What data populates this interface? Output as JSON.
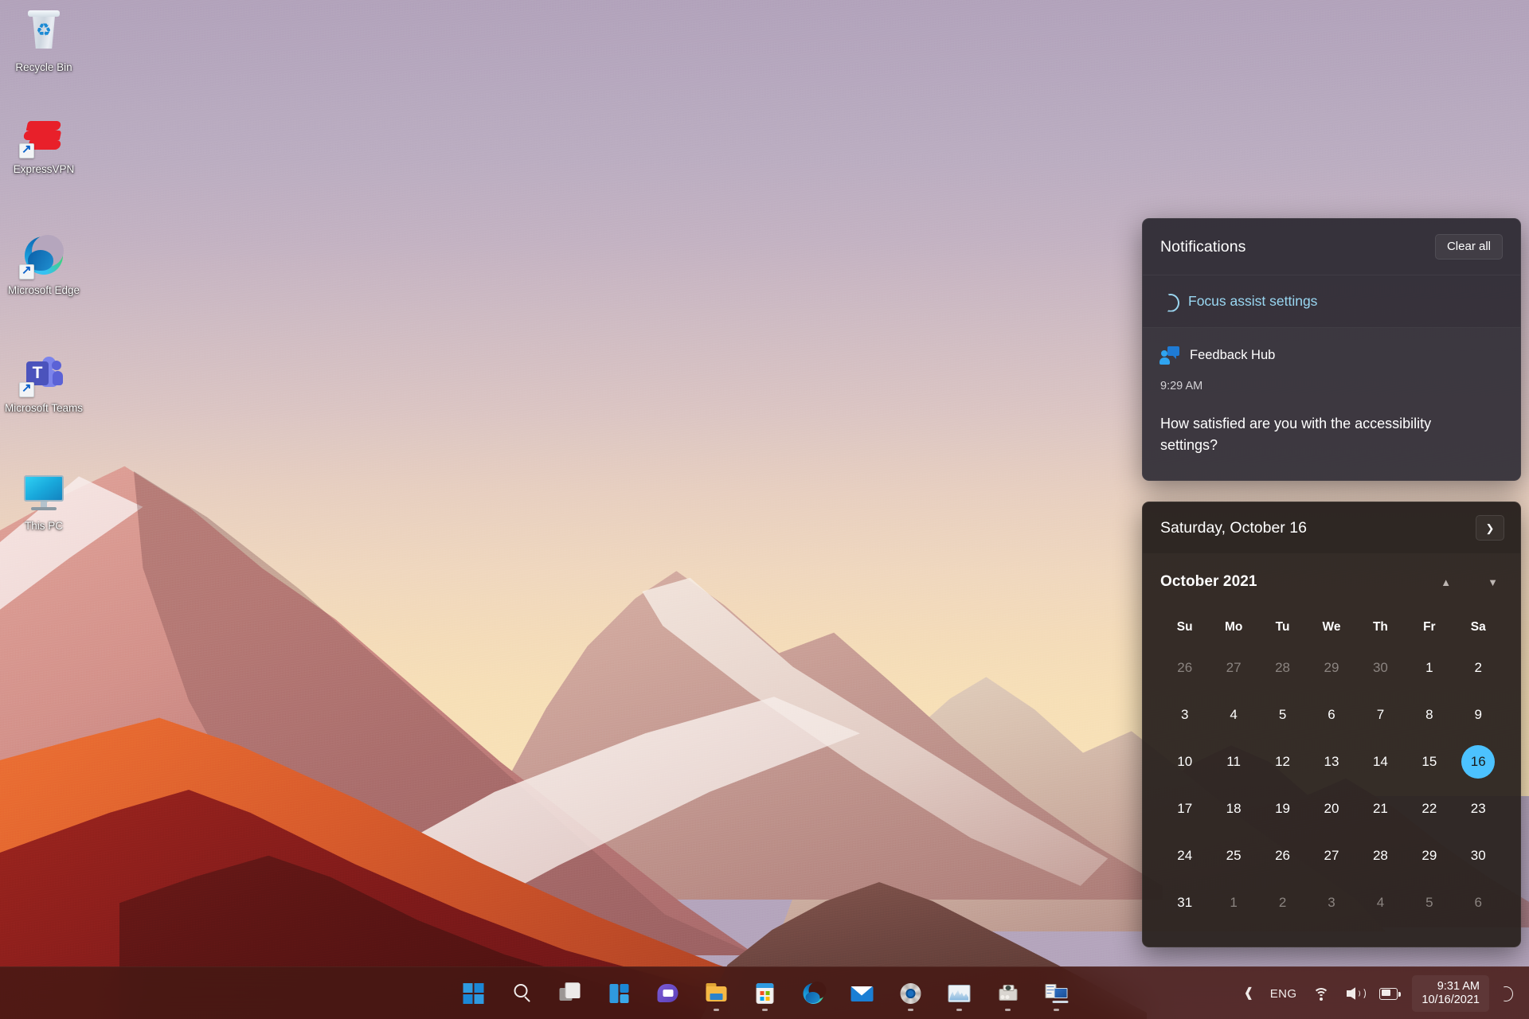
{
  "desktop": {
    "icons": [
      {
        "label": "Recycle Bin",
        "icon": "recycle-bin-icon",
        "shortcut": false
      },
      {
        "label": "ExpressVPN",
        "icon": "expressvpn-icon",
        "shortcut": true
      },
      {
        "label": "Microsoft Edge",
        "icon": "microsoft-edge-icon",
        "shortcut": true
      },
      {
        "label": "Microsoft Teams",
        "icon": "microsoft-teams-icon",
        "shortcut": true
      },
      {
        "label": "This PC",
        "icon": "this-pc-icon",
        "shortcut": false
      }
    ]
  },
  "notifications_panel": {
    "title": "Notifications",
    "clear_all_label": "Clear all",
    "focus_assist": {
      "label": "Focus assist settings",
      "icon": "crescent-moon-icon",
      "link_color": "#99d7f2"
    },
    "items": [
      {
        "app": "Feedback Hub",
        "app_icon": "feedback-hub-icon",
        "time": "9:29 AM",
        "body": "How satisfied are you with the accessibility settings?"
      }
    ]
  },
  "calendar_panel": {
    "selected_date_label": "Saturday, October 16",
    "collapse_icon": "chevron-down-icon",
    "month_label": "October 2021",
    "prev_month_icon": "triangle-up-icon",
    "next_month_icon": "triangle-down-icon",
    "day_headers": [
      "Su",
      "Mo",
      "Tu",
      "We",
      "Th",
      "Fr",
      "Sa"
    ],
    "today": 16,
    "accent_color": "#4cc2ff",
    "weeks": [
      [
        {
          "d": "26",
          "dim": true
        },
        {
          "d": "27",
          "dim": true
        },
        {
          "d": "28",
          "dim": true
        },
        {
          "d": "29",
          "dim": true
        },
        {
          "d": "30",
          "dim": true
        },
        {
          "d": "1",
          "dim": false
        },
        {
          "d": "2",
          "dim": false
        }
      ],
      [
        {
          "d": "3",
          "dim": false
        },
        {
          "d": "4",
          "dim": false
        },
        {
          "d": "5",
          "dim": false
        },
        {
          "d": "6",
          "dim": false
        },
        {
          "d": "7",
          "dim": false
        },
        {
          "d": "8",
          "dim": false
        },
        {
          "d": "9",
          "dim": false
        }
      ],
      [
        {
          "d": "10",
          "dim": false
        },
        {
          "d": "11",
          "dim": false
        },
        {
          "d": "12",
          "dim": false
        },
        {
          "d": "13",
          "dim": false
        },
        {
          "d": "14",
          "dim": false
        },
        {
          "d": "15",
          "dim": false
        },
        {
          "d": "16",
          "dim": false,
          "today": true
        }
      ],
      [
        {
          "d": "17",
          "dim": false
        },
        {
          "d": "18",
          "dim": false
        },
        {
          "d": "19",
          "dim": false
        },
        {
          "d": "20",
          "dim": false
        },
        {
          "d": "21",
          "dim": false
        },
        {
          "d": "22",
          "dim": false
        },
        {
          "d": "23",
          "dim": false
        }
      ],
      [
        {
          "d": "24",
          "dim": false
        },
        {
          "d": "25",
          "dim": false
        },
        {
          "d": "26",
          "dim": false
        },
        {
          "d": "27",
          "dim": false
        },
        {
          "d": "28",
          "dim": false
        },
        {
          "d": "29",
          "dim": false
        },
        {
          "d": "30",
          "dim": false
        }
      ],
      [
        {
          "d": "31",
          "dim": false
        },
        {
          "d": "1",
          "dim": true
        },
        {
          "d": "2",
          "dim": true
        },
        {
          "d": "3",
          "dim": true
        },
        {
          "d": "4",
          "dim": true
        },
        {
          "d": "5",
          "dim": true
        },
        {
          "d": "6",
          "dim": true
        }
      ]
    ]
  },
  "taskbar": {
    "background_color": "#46191 4",
    "buttons": [
      {
        "name": "start-button",
        "icon": "windows-logo-icon",
        "running": false
      },
      {
        "name": "search-button",
        "icon": "search-icon",
        "running": false
      },
      {
        "name": "task-view-button",
        "icon": "task-view-icon",
        "running": false
      },
      {
        "name": "widgets-button",
        "icon": "widgets-icon",
        "running": false
      },
      {
        "name": "chat-button",
        "icon": "teams-chat-icon",
        "running": false
      },
      {
        "name": "file-explorer-button",
        "icon": "file-explorer-icon",
        "running": true
      },
      {
        "name": "microsoft-store-button",
        "icon": "microsoft-store-icon",
        "running": true
      },
      {
        "name": "edge-button",
        "icon": "microsoft-edge-icon",
        "running": false
      },
      {
        "name": "mail-button",
        "icon": "mail-icon",
        "running": false
      },
      {
        "name": "settings-button",
        "icon": "gear-icon",
        "running": true
      },
      {
        "name": "task-manager-button",
        "icon": "performance-graph-icon",
        "running": true
      },
      {
        "name": "scanner-button",
        "icon": "scanner-device-icon",
        "running": true
      },
      {
        "name": "remote-desktop-button",
        "icon": "remote-management-icon",
        "running": true
      }
    ],
    "tray": {
      "hidden_icons_label": "^",
      "hidden_icons_icon": "chevron-up-icon",
      "language": "ENG",
      "wifi_icon": "wifi-icon",
      "volume_icon": "speaker-icon",
      "battery_icon": "battery-icon",
      "time": "9:31 AM",
      "date": "10/16/2021",
      "focus_assist_icon": "crescent-moon-icon"
    }
  }
}
